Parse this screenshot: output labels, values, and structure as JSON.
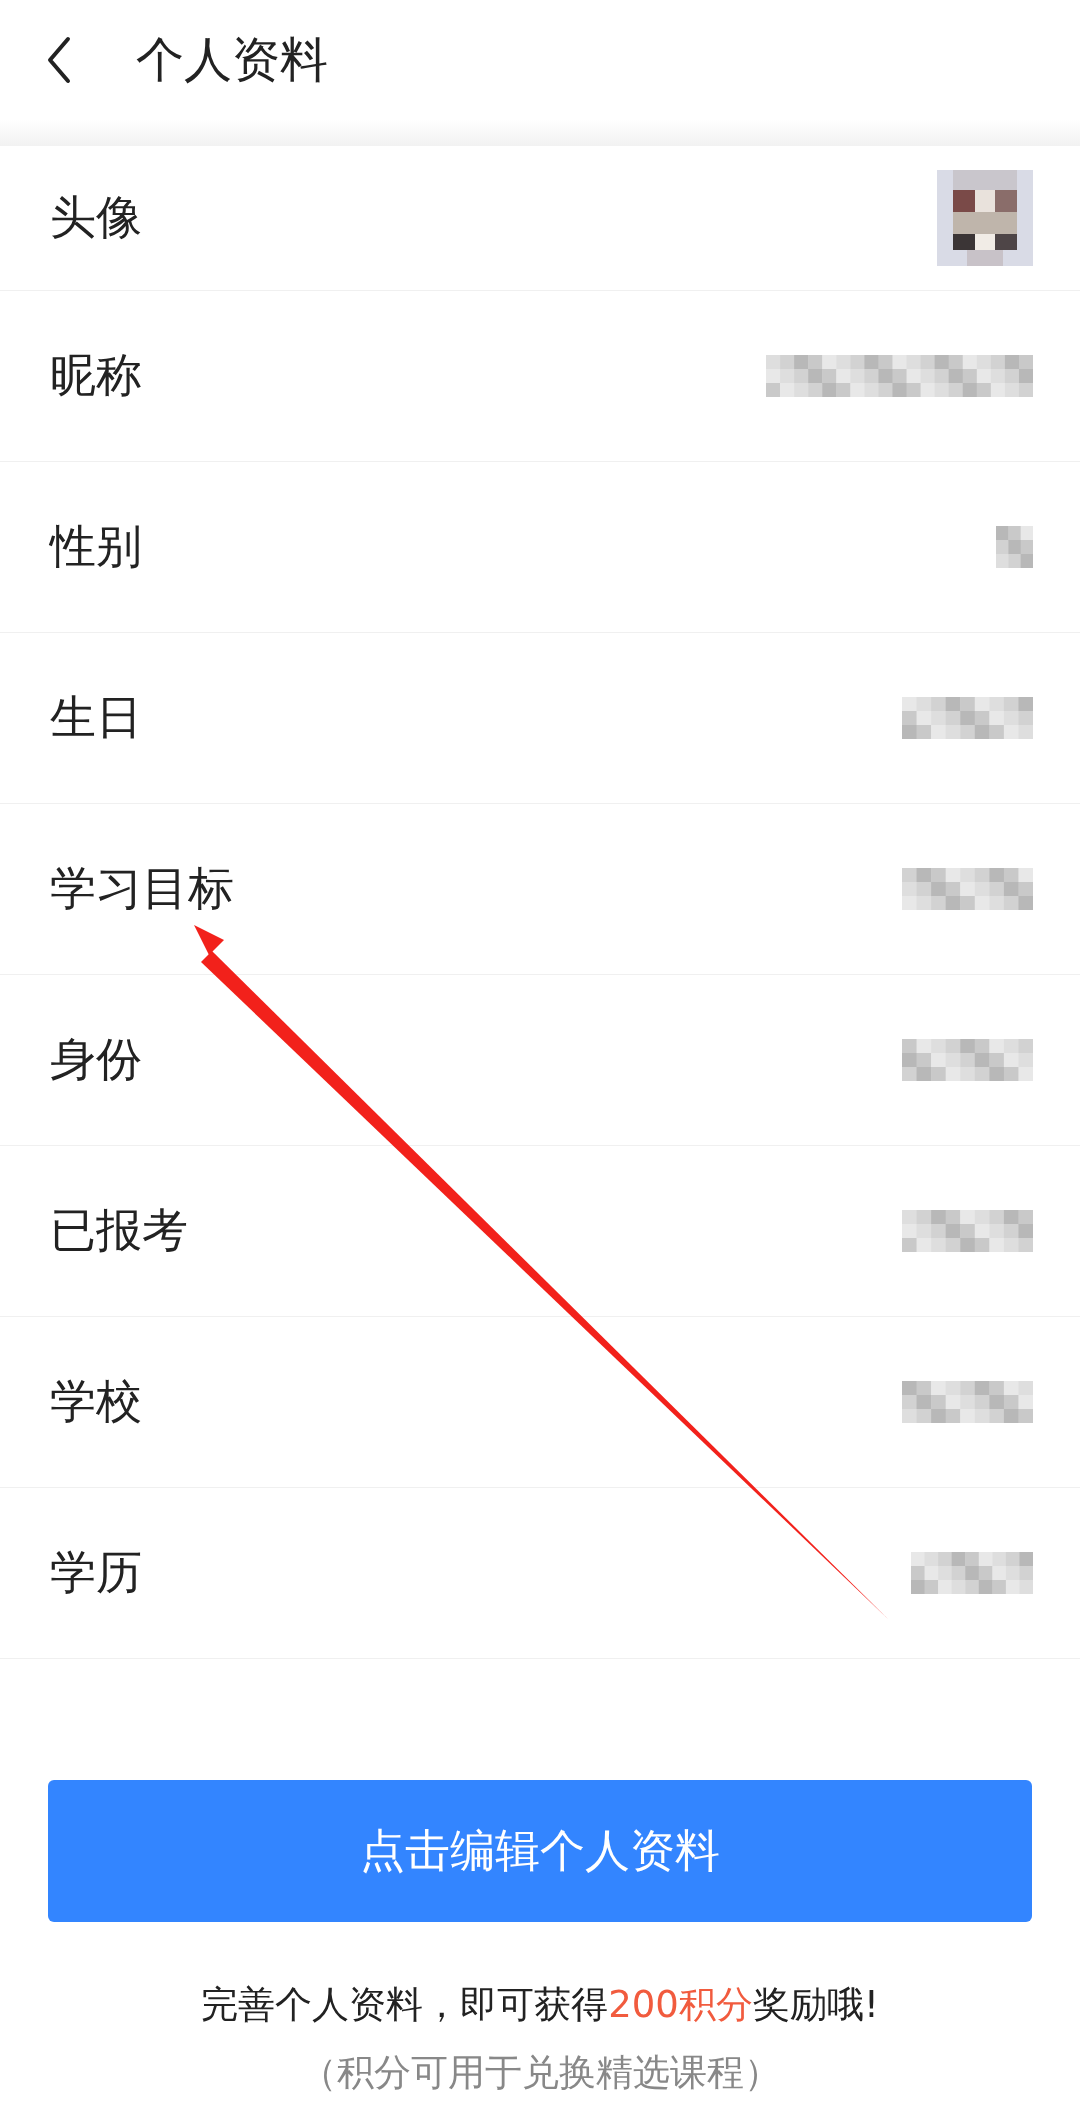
{
  "header": {
    "title": "个人资料"
  },
  "rows": [
    {
      "label": "头像",
      "kind": "avatar"
    },
    {
      "label": "昵称",
      "kind": "blurred"
    },
    {
      "label": "性别",
      "kind": "blurred"
    },
    {
      "label": "生日",
      "kind": "blurred"
    },
    {
      "label": "学习目标",
      "kind": "blurred"
    },
    {
      "label": "身份",
      "kind": "blurred"
    },
    {
      "label": "已报考",
      "kind": "blurred"
    },
    {
      "label": "学校",
      "kind": "blurred"
    },
    {
      "label": "学历",
      "kind": "blurred"
    }
  ],
  "edit_button": {
    "label": "点击编辑个人资料"
  },
  "reward_note": {
    "parts": [
      {
        "text": "完善个人资料，即可获得",
        "highlight": false
      },
      {
        "text": "200积分",
        "highlight": true
      },
      {
        "text": "奖励哦!",
        "highlight": false
      }
    ]
  },
  "reward_hint": "（积分可用于兑换精选课程）"
}
